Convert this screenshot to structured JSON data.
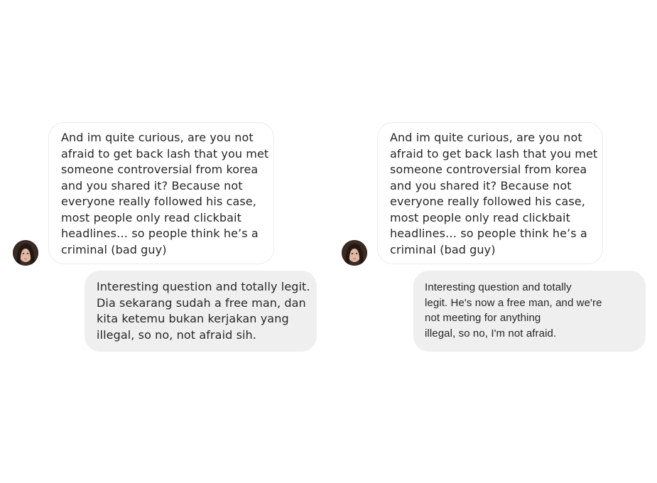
{
  "panels": [
    {
      "incoming_lines": [
        "And im quite curious, are you not",
        "afraid to get back lash that you met",
        "someone controversial from korea",
        "and you shared it? Because not",
        "everyone really followed his case,",
        "most people only read clickbait",
        "headlines… so people think he’s a",
        "criminal (bad guy)"
      ],
      "outgoing_lines": [
        "Interesting question and totally legit.",
        "Dia sekarang sudah a free man, dan",
        "kita ketemu bukan kerjakan yang",
        "illegal, so no, not afraid sih."
      ]
    },
    {
      "incoming_lines": [
        "And im quite curious, are you not",
        "afraid to get back lash that you met",
        "someone controversial from korea",
        "and you shared it? Because not",
        "everyone really followed his case,",
        "most people only read clickbait",
        "headlines… so people think he’s a",
        "criminal (bad guy)"
      ],
      "outgoing_lines": [
        "Interesting question and totally",
        "legit. He's now a free man, and we're",
        "not meeting for anything",
        "illegal, so no, I'm not afraid."
      ]
    }
  ],
  "colors": {
    "background": "#ffffff",
    "incoming_bubble": "#ffffff",
    "incoming_border": "#ececec",
    "outgoing_bubble": "#efefef",
    "text": "#262626"
  }
}
